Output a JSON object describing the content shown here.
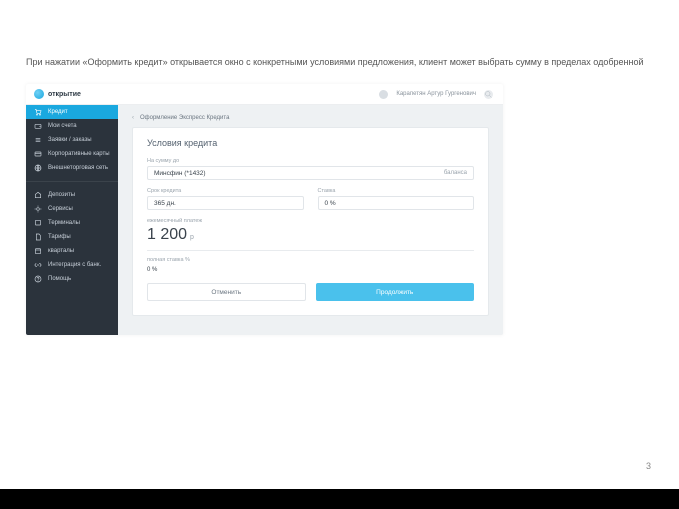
{
  "slide": {
    "caption": "При нажатии «Оформить кредит» открывается окно с конкретными условиями предложения, клиент может выбрать сумму в пределах одобренной",
    "page_number": "3"
  },
  "app": {
    "brand": "открытие",
    "user_name": "Карапетян Артур Гургенович",
    "sidebar": {
      "items": [
        {
          "label": "Кредит",
          "icon": "cart"
        },
        {
          "label": "Мои счета",
          "icon": "wallet"
        },
        {
          "label": "Заявки / заказы",
          "icon": "list"
        },
        {
          "label": "Корпоративные карты",
          "icon": "card"
        },
        {
          "label": "Внешнеторговая сеть",
          "icon": "globe"
        }
      ],
      "items2": [
        {
          "label": "Депозиты",
          "icon": "deposit"
        },
        {
          "label": "Сервисы",
          "icon": "services"
        },
        {
          "label": "Терминалы",
          "icon": "terminal"
        },
        {
          "label": "Тарифы",
          "icon": "doc"
        },
        {
          "label": "кварталы",
          "icon": "calendar"
        },
        {
          "label": "Интеграция с банк.",
          "icon": "link"
        },
        {
          "label": "Помощь",
          "icon": "help"
        }
      ]
    },
    "breadcrumb": "Оформление Экспресс Кредита",
    "form": {
      "title": "Условия кредита",
      "field1_label": "На сумму до",
      "field1_value": "Минсфин (*1432)",
      "field1_right": "баланса",
      "field2_label": "Срок кредита",
      "field2_value": "365 дн.",
      "field3_label": "Ставка",
      "field3_value": "0 %",
      "amount_label": "ежемесячный платеж",
      "amount_value": "1 200",
      "amount_currency": "р",
      "overpay_label": "полная ставка %",
      "overpay_value": "0 %",
      "cancel": "Отменить",
      "submit": "Продолжить"
    }
  }
}
